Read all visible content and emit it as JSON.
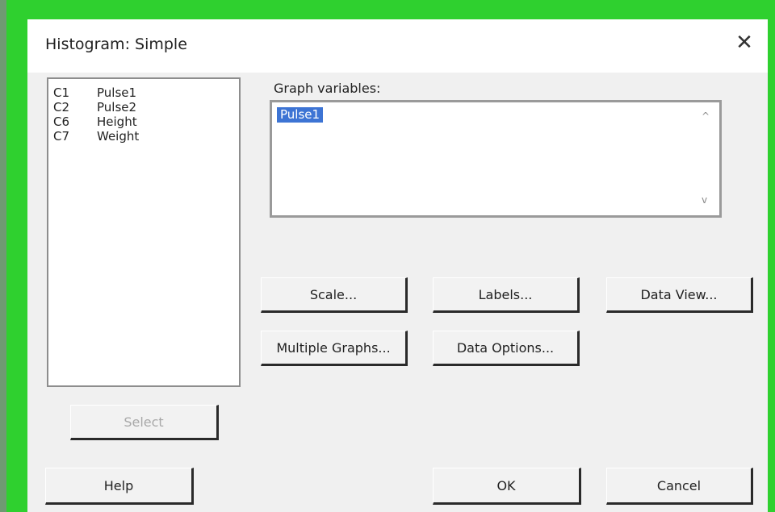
{
  "dialog": {
    "title": "Histogram: Simple",
    "close_glyph": "✕"
  },
  "variables": [
    {
      "col": "C1",
      "name": "Pulse1"
    },
    {
      "col": "C2",
      "name": "Pulse2"
    },
    {
      "col": "C6",
      "name": "Height"
    },
    {
      "col": "C7",
      "name": "Weight"
    }
  ],
  "graph_variables": {
    "label": "Graph variables:",
    "value": "Pulse1",
    "scroll_up": "^",
    "scroll_down": "v"
  },
  "buttons": {
    "scale": "Scale...",
    "labels": "Labels...",
    "data_view": "Data View...",
    "multiple_graphs": "Multiple Graphs...",
    "data_options": "Data Options...",
    "select": "Select",
    "help": "Help",
    "ok": "OK",
    "cancel": "Cancel"
  }
}
